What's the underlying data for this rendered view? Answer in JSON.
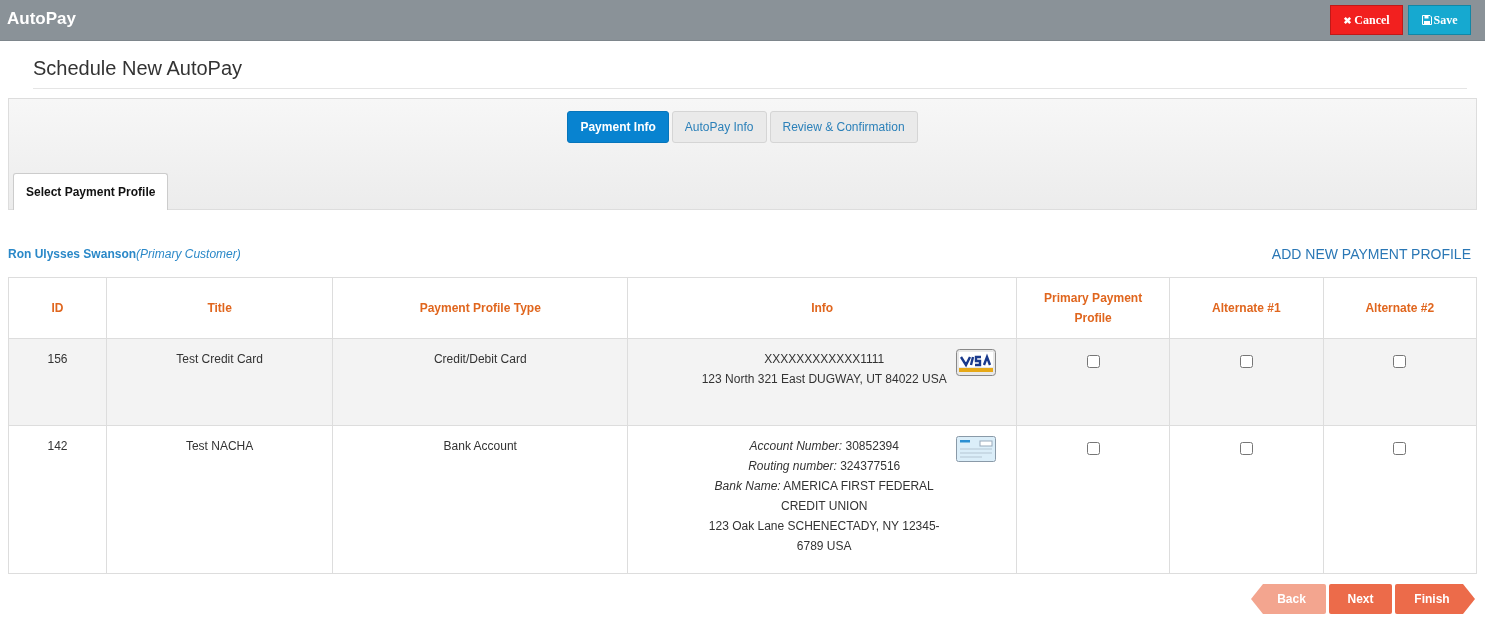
{
  "header": {
    "title": "AutoPay",
    "buttons": [
      {
        "label": "Cancel",
        "kind": "cancel"
      },
      {
        "label": "Save",
        "kind": "save"
      }
    ]
  },
  "page_title": "Schedule New AutoPay",
  "wizard_steps": [
    {
      "label": "Payment Info",
      "selected": true
    },
    {
      "label": "AutoPay Info",
      "selected": false
    },
    {
      "label": "Review & Confirmation",
      "selected": false
    }
  ],
  "section_tabs": [
    {
      "label": "Select Payment Profile",
      "selected": true
    }
  ],
  "customer": {
    "name": "Ron Ulysses Swanson",
    "role": "(Primary Customer)"
  },
  "add_profile_link": "ADD NEW PAYMENT PROFILE",
  "table": {
    "columns": [
      "ID",
      "Title",
      "Payment Profile Type",
      "Info",
      "Primary Payment Profile",
      "Alternate #1",
      "Alternate #2"
    ],
    "rows": [
      {
        "id": "156",
        "title": "Test Credit Card",
        "type": "Credit/Debit Card",
        "kind": "card",
        "info": [
          "XXXXXXXXXXXX1111",
          "123 North 321 East DUGWAY, UT 84022 USA"
        ],
        "choices": [
          {
            "checked": false
          },
          {
            "checked": false
          },
          {
            "checked": false
          }
        ]
      },
      {
        "id": "142",
        "title": "Test NACHA",
        "type": "Bank Account",
        "kind": "bank",
        "info": [
          "*Account Number:* 30852394",
          "*Routing number:* 324377516",
          "*Bank Name:* AMERICA FIRST FEDERAL CREDIT UNION",
          "123 Oak Lane SCHENECTADY, NY 12345-6789 USA"
        ],
        "choices": [
          {
            "checked": false
          },
          {
            "checked": false
          },
          {
            "checked": false
          }
        ]
      }
    ]
  },
  "nav_buttons": [
    {
      "label": "Back",
      "kind": "back",
      "disabled": true
    },
    {
      "label": "Next",
      "kind": "next",
      "disabled": false
    },
    {
      "label": "Finish",
      "kind": "finish",
      "disabled": false
    }
  ]
}
